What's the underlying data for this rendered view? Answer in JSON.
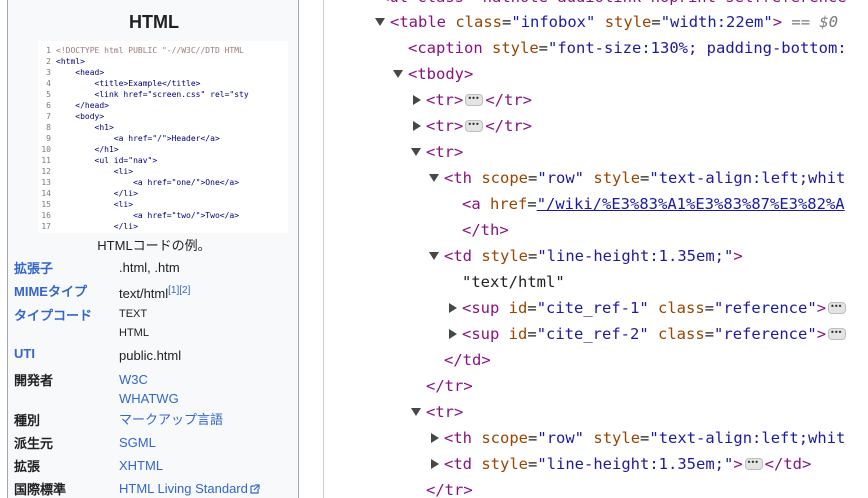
{
  "infobox": {
    "title": "HTML",
    "code_lines": [
      {
        "n": "1",
        "t": "<!DOCTYPE html PUBLIC \"-//W3C//DTD HTML"
      },
      {
        "n": "2",
        "t": "<html>"
      },
      {
        "n": "3",
        "t": "    <head>"
      },
      {
        "n": "4",
        "t": "        <title>Example</title>"
      },
      {
        "n": "5",
        "t": "        <link href=\"screen.css\" rel=\"sty"
      },
      {
        "n": "6",
        "t": "    </head>"
      },
      {
        "n": "7",
        "t": "    <body>"
      },
      {
        "n": "8",
        "t": "        <h1>"
      },
      {
        "n": "9",
        "t": "            <a href=\"/\">Header</a>"
      },
      {
        "n": "10",
        "t": "        </h1>"
      },
      {
        "n": "11",
        "t": "        <ul id=\"nav\">"
      },
      {
        "n": "12",
        "t": "            <li>"
      },
      {
        "n": "13",
        "t": "                <a href=\"one/\">One</a>"
      },
      {
        "n": "14",
        "t": "            </li>"
      },
      {
        "n": "15",
        "t": "            <li>"
      },
      {
        "n": "16",
        "t": "                <a href=\"two/\">Two</a>"
      },
      {
        "n": "17",
        "t": "            </li>"
      }
    ],
    "caption": "HTMLコードの例。",
    "rows": {
      "ext": {
        "label": "拡張子",
        "value": ".html, .htm"
      },
      "mime": {
        "label": "MIMEタイプ",
        "value": "text/html",
        "ref": "[1][2]"
      },
      "typecode": {
        "label": "タイプコード",
        "v1": "TEXT",
        "v2": "HTML"
      },
      "uti": {
        "label": "UTI",
        "value": "public.html"
      },
      "dev": {
        "label": "開発者",
        "v1": "W3C",
        "v2": "WHATWG"
      },
      "kind": {
        "label": "種別",
        "value": "マークアップ言語"
      },
      "from": {
        "label": "派生元",
        "value": "SGML"
      },
      "extend": {
        "label": "拡張",
        "value": "XHTML"
      },
      "std": {
        "label": "国際標準",
        "value": "HTML Living Standard"
      }
    }
  },
  "devtools": {
    "top_cut": "<ul class=\"hatnote audiolink noprint selfreference\"",
    "lines": {
      "l1": {
        "tag_open": "<table",
        "a1": "class",
        "v1": "\"infobox\"",
        "a2": "style",
        "v2": "\"width:22em\"",
        "tag_close": ">",
        "eq": "== $0"
      },
      "l2": {
        "tag_open": "<caption",
        "a1": "style",
        "v1": "\"font-size:130%; padding-bottom:"
      },
      "l3": {
        "tag": "<tbody>"
      },
      "l4": {
        "open": "<tr>",
        "close": "</tr>"
      },
      "l5": {
        "open": "<tr>",
        "close": "</tr>"
      },
      "l6": {
        "tag": "<tr>"
      },
      "l7": {
        "tag_open": "<th",
        "a1": "scope",
        "v1": "\"row\"",
        "a2": "style",
        "v2": "\"text-align:left;whit"
      },
      "l8": {
        "tag_open": "<a",
        "a1": "href",
        "v1": "\"/wiki/%E3%83%A1%E3%83%87%E3%82%A"
      },
      "l9": {
        "tag": "</th>"
      },
      "l10": {
        "tag_open": "<td",
        "a1": "style",
        "v1": "\"line-height:1.35em;\"",
        "tag_close": ">"
      },
      "l11": {
        "text": "\"text/html\""
      },
      "l12": {
        "tag_open": "<sup",
        "a1": "id",
        "v1": "\"cite_ref-1\"",
        "a2": "class",
        "v2": "\"reference\"",
        "tag_close": ">"
      },
      "l13": {
        "tag_open": "<sup",
        "a1": "id",
        "v1": "\"cite_ref-2\"",
        "a2": "class",
        "v2": "\"reference\"",
        "tag_close": ">"
      },
      "l14": {
        "tag": "</td>"
      },
      "l15": {
        "tag": "</tr>"
      },
      "l16": {
        "tag": "<tr>"
      },
      "l17": {
        "tag_open": "<th",
        "a1": "scope",
        "v1": "\"row\"",
        "a2": "style",
        "v2": "\"text-align:left;whit"
      },
      "l18": {
        "tag_open": "<td",
        "a1": "style",
        "v1": "\"line-height:1.35em;\"",
        "tag_close": ">",
        "close": "</td>"
      },
      "l19": {
        "tag": "</tr>"
      }
    }
  },
  "colors": {
    "tag": "#881280",
    "attr_name": "#994500",
    "attr_value": "#1a1aa6",
    "link": "#3366cc"
  }
}
